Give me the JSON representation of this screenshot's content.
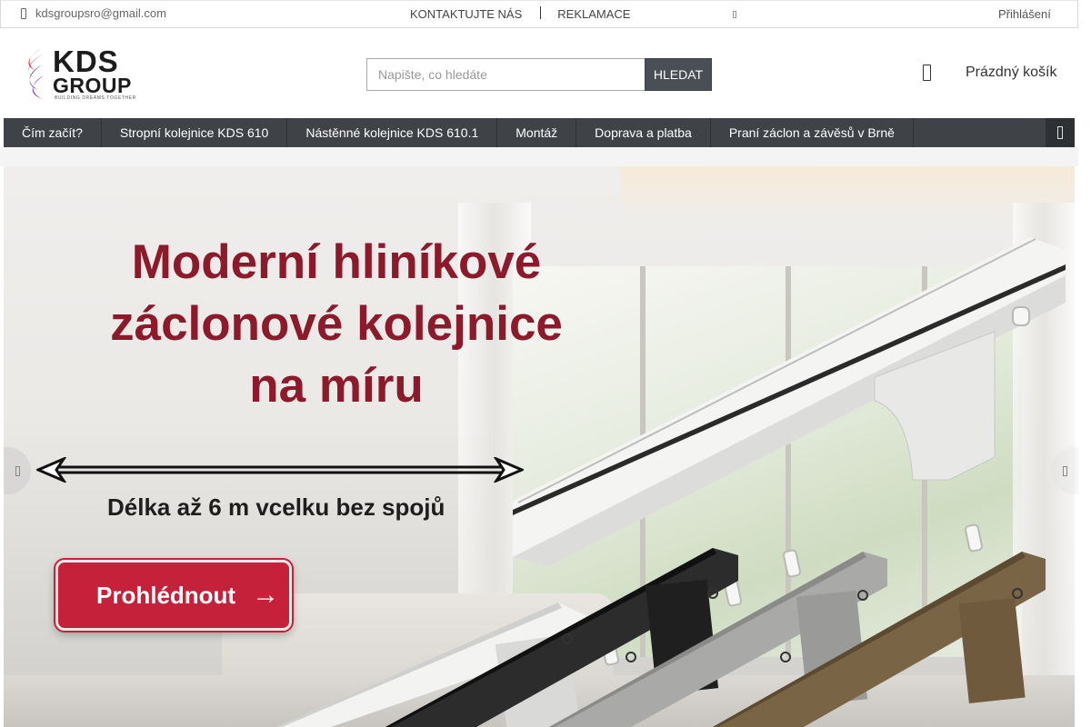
{
  "topbar": {
    "email": "kdsgroupsro@gmail.com",
    "email_icon": "mail-icon",
    "links": [
      "KONTAKTUJTE NÁS",
      "REKLAMACE"
    ],
    "login": "Přihlášení"
  },
  "header": {
    "logo": {
      "name": "KDS",
      "sub": "GROUP",
      "tagline": "BUILDING DREAMS TOGETHER"
    },
    "search": {
      "placeholder": "Napište, co hledáte",
      "value": "",
      "button": "HLEDAT"
    },
    "cart": {
      "label": "Prázdný košík",
      "icon": "cart-icon"
    }
  },
  "nav": {
    "items": [
      "Čím začít?",
      "Stropní kolejnice KDS 610",
      "Nástěnné kolejnice KDS 610.1",
      "Montáž",
      "Doprava a platba",
      "Praní záclon a závěsů v Brně"
    ],
    "menu_icon": "menu-icon"
  },
  "hero": {
    "headline": [
      "Moderní hliníkové",
      "záclonové kolejnice",
      "na míru"
    ],
    "subline": "Délka až 6 m vcelku bez spojů",
    "cta": "Prohlédnout",
    "cta_arrow": "→",
    "rail_colors": [
      "#f3f3f1",
      "#2c2c2c",
      "#a9a9a7",
      "#7a6446"
    ],
    "accent_color": "#8c1a2b",
    "cta_color": "#c6213a"
  }
}
